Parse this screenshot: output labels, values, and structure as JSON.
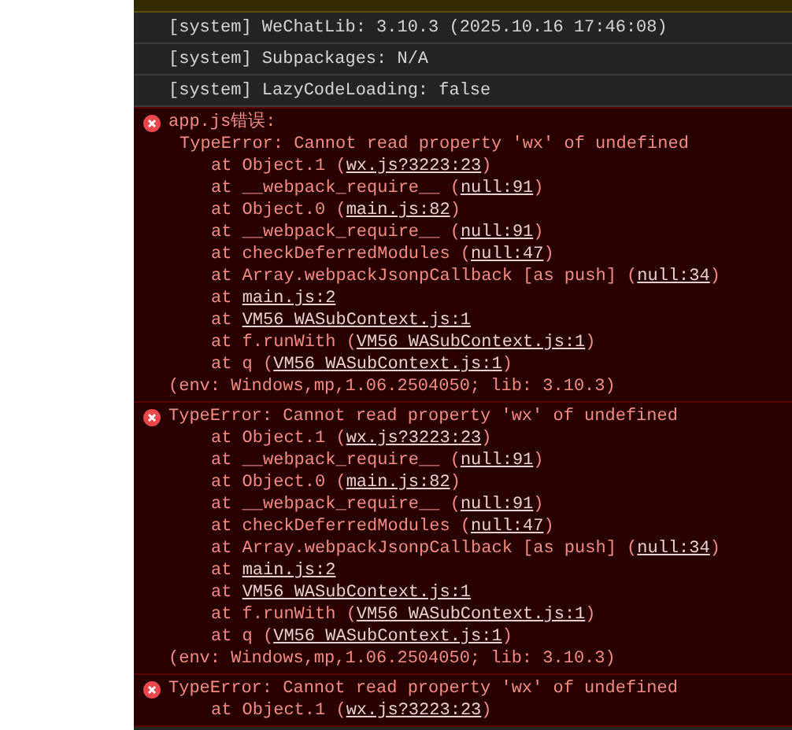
{
  "log": [
    {
      "kind": "warning"
    },
    {
      "kind": "system",
      "text": "[system] WeChatLib: 3.10.3 (2025.10.16 17:46:08)"
    },
    {
      "kind": "system",
      "text": "[system] Subpackages: N/A"
    },
    {
      "kind": "system",
      "text": "[system] LazyCodeLoading: false"
    },
    {
      "kind": "error",
      "title": "app.js错误:",
      "message": "TypeError: Cannot read property 'wx' of undefined",
      "frames": [
        {
          "prefix": "at Object.1 (",
          "link": "wx.js?3223:23",
          "suffix": ")"
        },
        {
          "prefix": "at __webpack_require__ (",
          "link": "null:91",
          "suffix": ")"
        },
        {
          "prefix": "at Object.0 (",
          "link": "main.js:82",
          "suffix": ")"
        },
        {
          "prefix": "at __webpack_require__ (",
          "link": "null:91",
          "suffix": ")"
        },
        {
          "prefix": "at checkDeferredModules (",
          "link": "null:47",
          "suffix": ")"
        },
        {
          "prefix": "at Array.webpackJsonpCallback [as push] (",
          "link": "null:34",
          "suffix": ")"
        },
        {
          "prefix": "at ",
          "link": "main.js:2"
        },
        {
          "prefix": "at ",
          "link": "VM56 WASubContext.js:1"
        },
        {
          "prefix": "at f.runWith (",
          "link": "VM56 WASubContext.js:1",
          "suffix": ")"
        },
        {
          "prefix": "at q (",
          "link": "VM56 WASubContext.js:1",
          "suffix": ")"
        }
      ],
      "env": "(env: Windows,mp,1.06.2504050; lib: 3.10.3)"
    },
    {
      "kind": "error",
      "message": "TypeError: Cannot read property 'wx' of undefined",
      "frames": [
        {
          "prefix": "at Object.1 (",
          "link": "wx.js?3223:23",
          "suffix": ")"
        },
        {
          "prefix": "at __webpack_require__ (",
          "link": "null:91",
          "suffix": ")"
        },
        {
          "prefix": "at Object.0 (",
          "link": "main.js:82",
          "suffix": ")"
        },
        {
          "prefix": "at __webpack_require__ (",
          "link": "null:91",
          "suffix": ")"
        },
        {
          "prefix": "at checkDeferredModules (",
          "link": "null:47",
          "suffix": ")"
        },
        {
          "prefix": "at Array.webpackJsonpCallback [as push] (",
          "link": "null:34",
          "suffix": ")"
        },
        {
          "prefix": "at ",
          "link": "main.js:2"
        },
        {
          "prefix": "at ",
          "link": "VM56 WASubContext.js:1"
        },
        {
          "prefix": "at f.runWith (",
          "link": "VM56 WASubContext.js:1",
          "suffix": ")"
        },
        {
          "prefix": "at q (",
          "link": "VM56 WASubContext.js:1",
          "suffix": ")"
        }
      ],
      "env": "(env: Windows,mp,1.06.2504050; lib: 3.10.3)"
    },
    {
      "kind": "error",
      "message": "TypeError: Cannot read property 'wx' of undefined",
      "frames": [
        {
          "prefix": "at Object.1 (",
          "link": "wx.js?3223:23",
          "suffix": ")"
        }
      ]
    }
  ]
}
